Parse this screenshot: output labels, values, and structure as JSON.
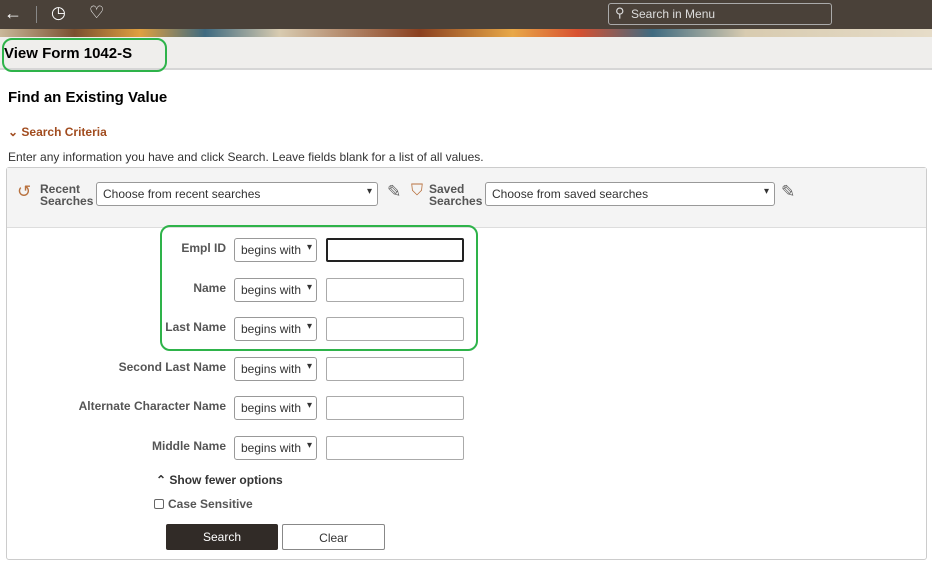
{
  "header": {
    "search_placeholder": "Search in Menu"
  },
  "page": {
    "title": "View Form 1042-S",
    "heading": "Find an Existing Value",
    "criteria": "Search Criteria",
    "info": "Enter any information you have and click Search. Leave fields blank for a list of all values."
  },
  "recent": {
    "label1": "Recent",
    "label2": "Searches",
    "value": "Choose from recent searches"
  },
  "saved": {
    "label1": "Saved",
    "label2": "Searches",
    "value": "Choose from saved searches"
  },
  "fields": [
    {
      "label": "Empl ID",
      "op": "begins with",
      "value": ""
    },
    {
      "label": "Name",
      "op": "begins with",
      "value": ""
    },
    {
      "label": "Last Name",
      "op": "begins with",
      "value": ""
    },
    {
      "label": "Second Last Name",
      "op": "begins with",
      "value": ""
    },
    {
      "label": "Alternate Character Name",
      "op": "begins with",
      "value": ""
    },
    {
      "label": "Middle Name",
      "op": "begins with",
      "value": ""
    }
  ],
  "options": {
    "fewer": "Show fewer options",
    "case": "Case Sensitive"
  },
  "buttons": {
    "search": "Search",
    "clear": "Clear"
  },
  "colors": {
    "accent": "#a14c1f",
    "highlight": "#2eb34a",
    "topbar": "#4a4139"
  }
}
